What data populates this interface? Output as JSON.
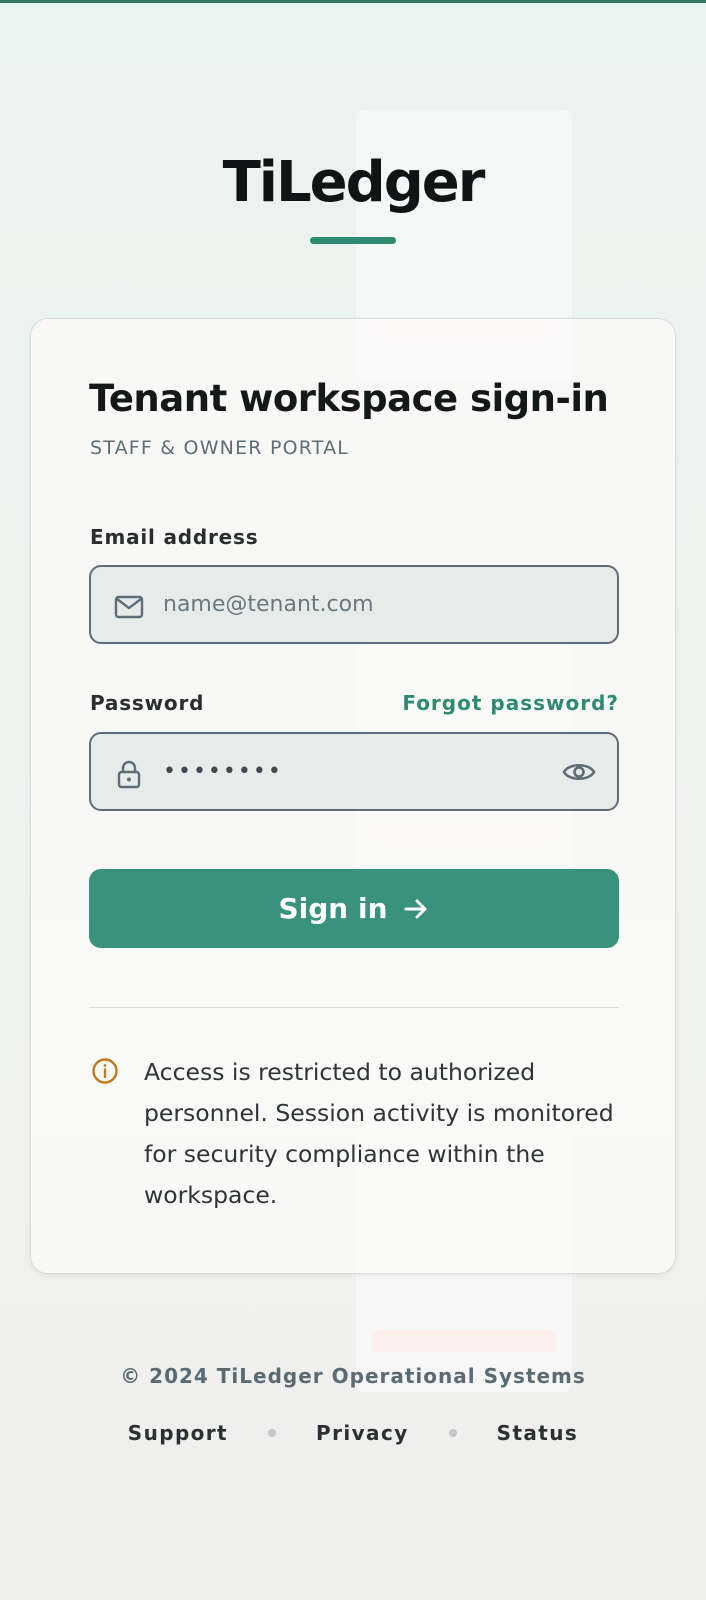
{
  "brand": {
    "name": "TiLedger"
  },
  "card": {
    "title": "Tenant workspace sign-in",
    "subtitle": "STAFF & OWNER PORTAL"
  },
  "email": {
    "label": "Email address",
    "placeholder": "name@tenant.com",
    "value": "",
    "icon": "mail-icon"
  },
  "password": {
    "label": "Password",
    "value": "••••••••",
    "forgot_label": "Forgot password?",
    "icon": "lock-icon",
    "toggle_icon": "eye-icon"
  },
  "signin": {
    "label": "Sign in",
    "icon": "arrow-right-icon"
  },
  "notice": {
    "icon": "info-icon",
    "text": "Access is restricted to authorized personnel. Session activity is monitored for security compliance within the workspace."
  },
  "footer": {
    "copyright": "© 2024 TiLedger Operational Systems",
    "links": [
      "Support",
      "Privacy",
      "Status"
    ]
  },
  "colors": {
    "accent": "#38927e",
    "brand_underline": "#2f8a72",
    "notice_icon": "#c07a1c",
    "field_border": "#5f6d78"
  }
}
